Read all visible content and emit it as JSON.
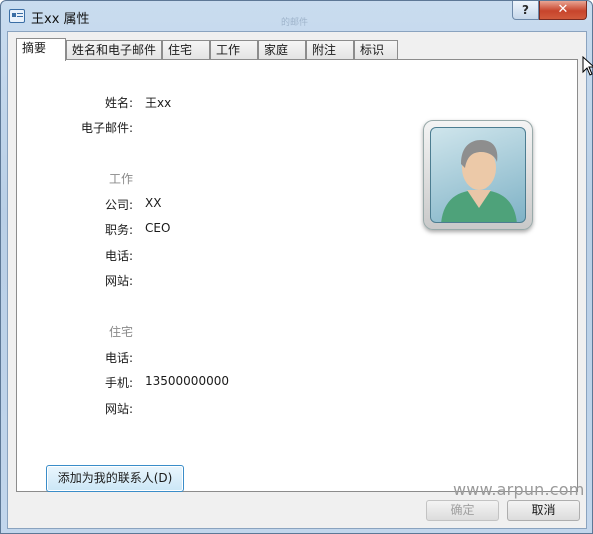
{
  "window": {
    "title": "王xx 属性",
    "ghost_title": "的邮件",
    "help_label": "?",
    "close_label": "✕"
  },
  "tabs": [
    {
      "label": "摘要",
      "active": true
    },
    {
      "label": "姓名和电子邮件",
      "active": false
    },
    {
      "label": "住宅",
      "active": false
    },
    {
      "label": "工作",
      "active": false
    },
    {
      "label": "家庭",
      "active": false
    },
    {
      "label": "附注",
      "active": false
    },
    {
      "label": "标识",
      "active": false
    }
  ],
  "summary": {
    "name_label": "姓名:",
    "name_value": "王xx",
    "email_label": "电子邮件:",
    "email_value": "",
    "work_section": "工作",
    "company_label": "公司:",
    "company_value": "XX",
    "title_label": "职务:",
    "title_value": "CEO",
    "work_phone_label": "电话:",
    "work_phone_value": "",
    "work_site_label": "网站:",
    "work_site_value": "",
    "home_section": "住宅",
    "home_phone_label": "电话:",
    "home_phone_value": "",
    "mobile_label": "手机:",
    "mobile_value": "13500000000",
    "home_site_label": "网站:",
    "home_site_value": "",
    "avatar_icon": "contact-avatar-icon"
  },
  "buttons": {
    "add_contact": "添加为我的联系人(D)",
    "ok": "确定",
    "cancel": "取消"
  },
  "watermark": "www.arpun.com",
  "colors": {
    "titlebar": "#c2d6ec",
    "close": "#c7442c",
    "focus_border": "#3a8dc9"
  }
}
